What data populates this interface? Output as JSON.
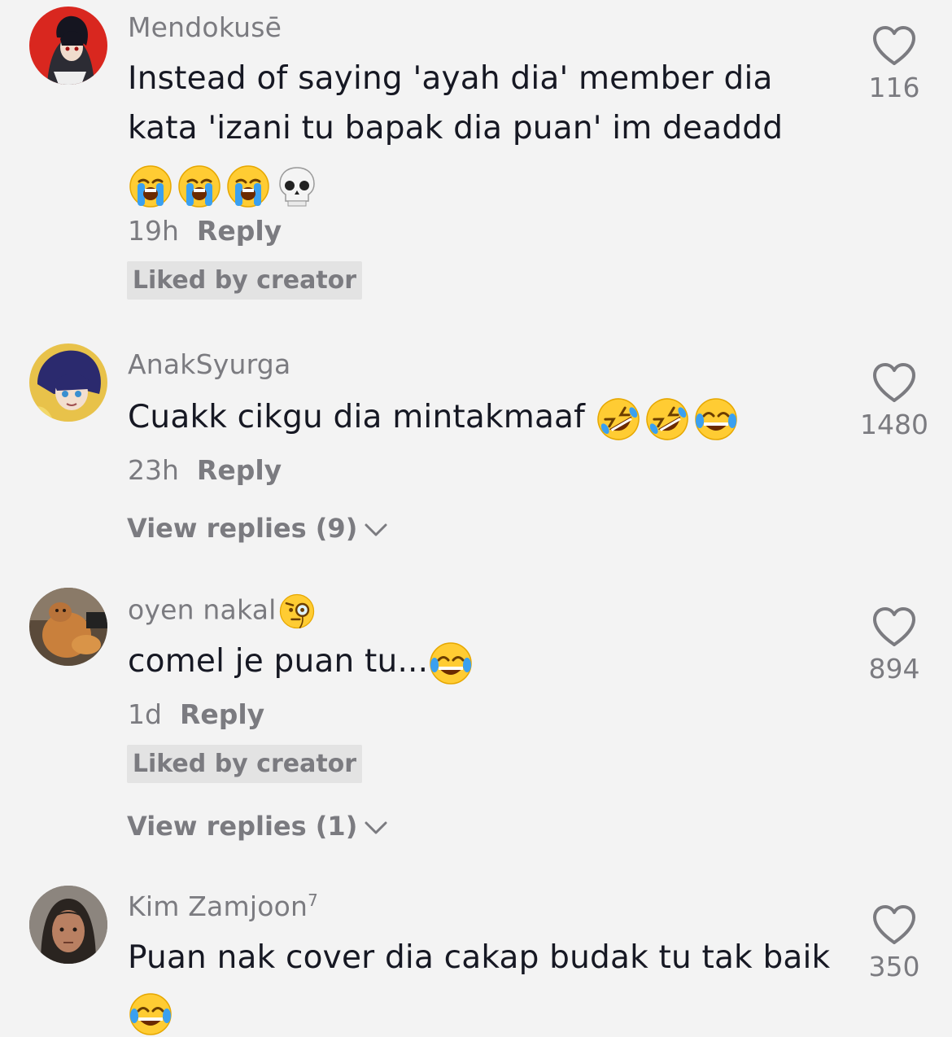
{
  "comments": [
    {
      "username": "Mendokusē",
      "text_lines": [
        "Instead of saying 'ayah dia' member dia",
        "kata 'izani tu bapak dia puan' im deaddd"
      ],
      "emojis": [
        "loudly-crying-face",
        "loudly-crying-face",
        "loudly-crying-face",
        "skull"
      ],
      "time": "19h",
      "reply_label": "Reply",
      "badge": "Liked by creator",
      "likes": "116"
    },
    {
      "username": "AnakSyurga",
      "text": "Cuakk cikgu dia mintakmaaf",
      "emojis": [
        "rolling-on-floor-laughing",
        "rolling-on-floor-laughing",
        "face-with-tears-of-joy"
      ],
      "time": "23h",
      "reply_label": "Reply",
      "view_replies": "View replies (9)",
      "likes": "1480"
    },
    {
      "username": "oyen nakal",
      "username_emoji": "face-with-monocle",
      "text": "comel je puan tu...",
      "emojis": [
        "face-with-tears-of-joy"
      ],
      "time": "1d",
      "reply_label": "Reply",
      "badge": "Liked by creator",
      "view_replies": "View replies (1)",
      "likes": "894"
    },
    {
      "username": "Kim Zamjoon",
      "username_sup": "7",
      "text": "Puan nak cover dia cakap budak tu tak baik",
      "emojis": [
        "face-with-tears-of-joy"
      ],
      "likes": "350"
    }
  ],
  "colors": {
    "background": "#f3f3f3",
    "text_primary": "#161823",
    "text_secondary": "#7b7b80",
    "badge_bg": "#e3e3e3"
  }
}
